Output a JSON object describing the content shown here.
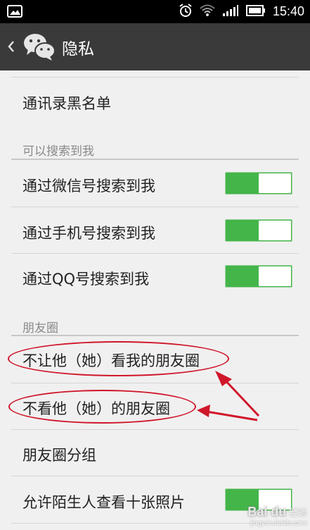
{
  "status_bar": {
    "time": "15:40"
  },
  "header": {
    "title": "隐私"
  },
  "rows": {
    "blacklist": "通讯录黑名单",
    "search_section": "可以搜索到我",
    "search_wechat_id": "通过微信号搜索到我",
    "search_phone": "通过手机号搜索到我",
    "search_qq": "通过QQ号搜索到我",
    "moments_section": "朋友圈",
    "hide_my_moments": "不让他（她）看我的朋友圈",
    "hide_their_moments": "不看他（她）的朋友圈",
    "moments_groups": "朋友圈分组",
    "stranger_photos": "允许陌生人查看十张照片"
  },
  "toggles": {
    "search_wechat_id": true,
    "search_phone": true,
    "search_qq": true,
    "stranger_photos": true
  },
  "watermark": {
    "brand": "Bai du",
    "text": "经验",
    "url": "jingyan.baidu.com"
  },
  "colors": {
    "toggle_on": "#44b549",
    "annotation": "#d0162a",
    "header_bg": "#3a3a3a"
  }
}
